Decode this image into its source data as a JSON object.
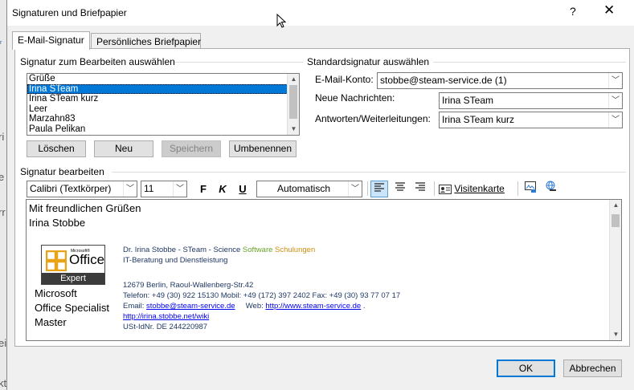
{
  "window": {
    "title": "Signaturen und Briefpapier",
    "help": "?",
    "close": "✕"
  },
  "background": {
    "fragments": [
      "Ir",
      "ri",
      "e",
      "rr",
      "ei",
      "ktakt"
    ]
  },
  "tabs": [
    {
      "label": "E-Mail-Signatur",
      "active": true
    },
    {
      "label": "Persönliches Briefpapier",
      "active": false
    }
  ],
  "select_section": {
    "heading": "Signatur zum Bearbeiten auswählen",
    "items": [
      "Grüße",
      "Irina STeam",
      "Irina STeam kurz",
      "Leer",
      "Marzahn83",
      "Paula Pelikan"
    ],
    "selected_index": 1,
    "buttons": {
      "delete": "Löschen",
      "new": "Neu",
      "save": "Speichern",
      "rename": "Umbenennen"
    }
  },
  "default_section": {
    "heading": "Standardsignatur auswählen",
    "email_label": "E-Mail-Konto:",
    "email_value": "stobbe@steam-service.de (1)",
    "new_label": "Neue Nachrichten:",
    "new_value": "Irina STeam",
    "reply_label": "Antworten/Weiterleitungen:",
    "reply_value": "Irina STeam kurz"
  },
  "edit_section": {
    "heading": "Signatur bearbeiten",
    "font": "Calibri (Textkörper)",
    "size": "11",
    "bold": "F",
    "italic": "K",
    "underline": "U",
    "color": "Automatisch",
    "business_card": "Visitenkarte"
  },
  "editor": {
    "line1": "Mit freundlichen Grüßen",
    "line2": "Irina Stobbe",
    "logo": {
      "small": "Microsoft®",
      "office": "Office",
      "expert": "Expert"
    },
    "cert": [
      "Microsoft",
      "Office Specialist",
      "Master"
    ],
    "sig": {
      "name": "Dr. Irina Stobbe - STeam  -  Science ",
      "software": "Software",
      "schulungen": " Schulungen",
      "line2": "IT-Beratung und Dienstleistung",
      "address": "12679 Berlin, Raoul-Wallenberg-Str.42",
      "phone": "Telefon: +49 (30) 922 15130        Mobil: +49 (172) 397 2402   Fax: +49 (30) 93 77 07 17",
      "email_label": "Email: ",
      "email": "stobbe@steam-service.de",
      "web_label": "     Web: ",
      "web": "http://www.steam-service.de",
      "web_after": " .",
      "wiki": "http://irina.stobbe.net/wiki",
      "vat": "USt-IdNr. DE 244220987"
    }
  },
  "footer": {
    "ok": "OK",
    "cancel": "Abbrechen"
  }
}
